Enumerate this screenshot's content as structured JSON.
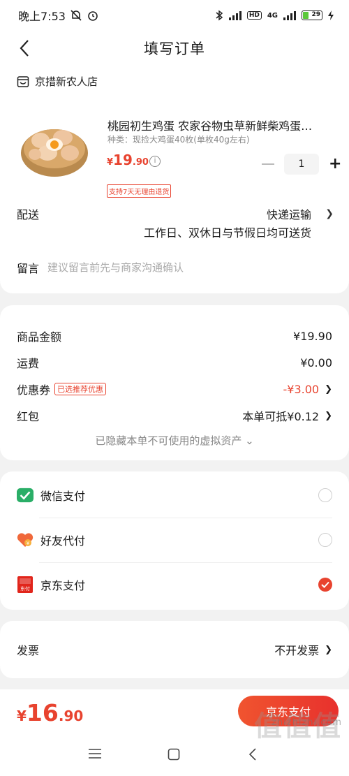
{
  "status_bar": {
    "time": "晚上7:53",
    "network": "4G",
    "battery": "29"
  },
  "header": {
    "title": "填写订单"
  },
  "shop": {
    "name": "京措新农人店"
  },
  "product": {
    "title": "桃园初生鸡蛋 农家谷物虫草新鲜柴鸡蛋…",
    "spec": "种类：现捡大鸡蛋40枚(单枚40g左右)",
    "price_currency": "¥",
    "price_int": "19",
    "price_dec": ".90",
    "quantity": "1",
    "return_tag": "支持7天无理由退货"
  },
  "shipping": {
    "label": "配送",
    "method": "快递运输",
    "note": "工作日、双休日与节假日均可送货"
  },
  "message": {
    "label": "留言",
    "placeholder": "建议留言前先与商家沟通确认"
  },
  "amounts": {
    "goods_label": "商品金额",
    "goods_value": "¥19.90",
    "freight_label": "运费",
    "freight_value": "¥0.00",
    "coupon_label": "优惠券",
    "coupon_badge": "已选推荐优惠",
    "coupon_value": "-¥3.00",
    "redpacket_label": "红包",
    "redpacket_value": "本单可抵¥0.12",
    "hidden_note": "已隐藏本单不可使用的虚拟资产 ⌄"
  },
  "payment": {
    "options": [
      {
        "label": "微信支付",
        "selected": false
      },
      {
        "label": "好友代付",
        "selected": false
      },
      {
        "label": "京东支付",
        "selected": true
      }
    ]
  },
  "invoice": {
    "label": "发票",
    "value": "不开发票"
  },
  "footer": {
    "total_currency": "¥",
    "total_int": "16",
    "total_dec": ".90",
    "pay_button": "京东支付",
    "watermark": "zhizhizhi.com",
    "watermark_big": "值值值"
  },
  "colors": {
    "accent": "#e8432f",
    "wechat": "#2aae67"
  }
}
